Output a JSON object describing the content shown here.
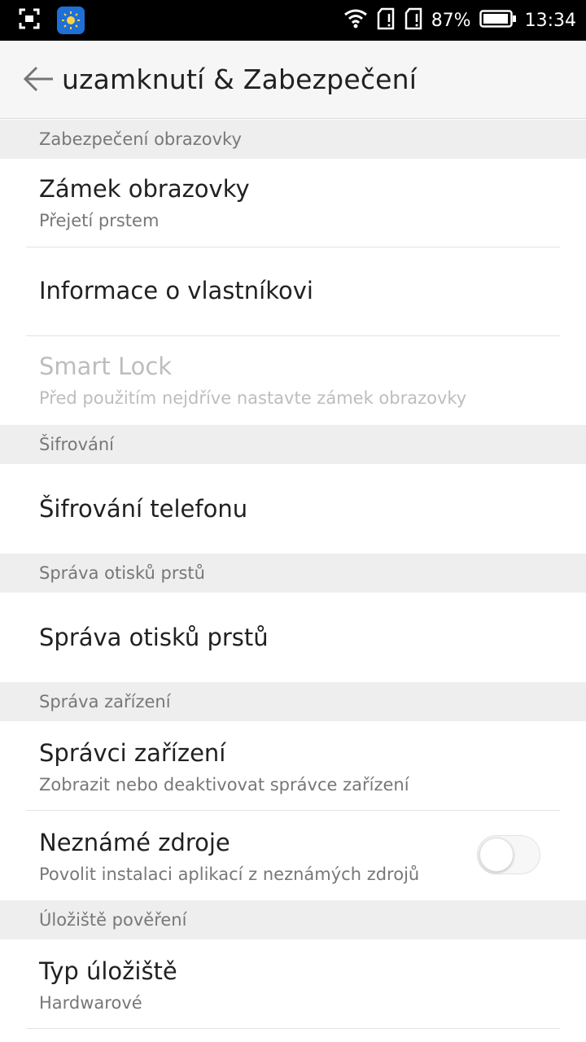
{
  "status_bar": {
    "battery_percent": "87%",
    "time": "13:34",
    "icons": [
      "screenshot-icon",
      "weather-app-icon",
      "wifi-icon",
      "sim1-icon",
      "sim2-icon",
      "battery-icon"
    ]
  },
  "app_bar": {
    "title": "uzamknutí & Zabezpečení",
    "back_icon": "arrow-left-icon"
  },
  "sections": {
    "screen_security": {
      "header": "Zabezpečení obrazovky"
    },
    "encryption": {
      "header": "Šifrování"
    },
    "fingerprint": {
      "header": "Správa otisků prstů"
    },
    "device_admin": {
      "header": "Správa zařízení"
    },
    "credential_storage": {
      "header": "Úložiště pověření"
    }
  },
  "items": {
    "screen_lock": {
      "title": "Zámek obrazovky",
      "subtitle": "Přejetí prstem"
    },
    "owner_info": {
      "title": "Informace o vlastníkovi"
    },
    "smart_lock": {
      "title": "Smart Lock",
      "subtitle": "Před použitím nejdříve nastavte zámek obrazovky",
      "enabled": false
    },
    "phone_encryption": {
      "title": "Šifrování telefonu"
    },
    "fingerprint_mgmt": {
      "title": "Správa otisků prstů"
    },
    "device_admins": {
      "title": "Správci zařízení",
      "subtitle": "Zobrazit nebo deaktivovat správce zařízení"
    },
    "unknown_sources": {
      "title": "Neznámé zdroje",
      "subtitle": "Povolit instalaci aplikací z neznámých zdrojů",
      "toggle_on": false
    },
    "storage_type": {
      "title": "Typ úložiště",
      "subtitle": "Hardwarové"
    }
  },
  "colors": {
    "status_bar_bg": "#000000",
    "app_bar_bg": "#f6f6f6",
    "section_bg": "#eeeeee",
    "primary_text": "#212121",
    "secondary_text": "#777777",
    "disabled_text": "#bdbdbd"
  }
}
